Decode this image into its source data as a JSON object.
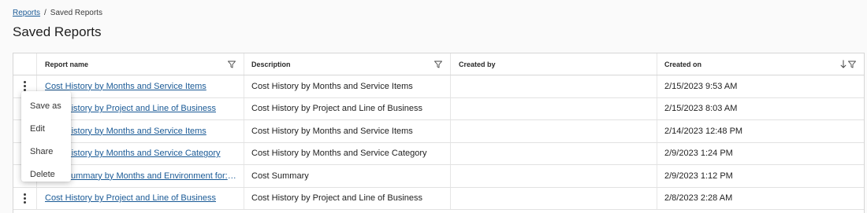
{
  "breadcrumb": {
    "root": "Reports",
    "separator": "/",
    "current": "Saved Reports"
  },
  "page": {
    "title": "Saved Reports"
  },
  "columns": {
    "name": "Report name",
    "description": "Description",
    "created_by": "Created by",
    "created_on": "Created on"
  },
  "sort": {
    "column": "Created on",
    "direction": "descending"
  },
  "rows": [
    {
      "name": "Cost History by Months and Service Items",
      "description": "Cost History by Months and Service Items",
      "created_by": "",
      "created_on": "2/15/2023 9:53 AM"
    },
    {
      "name": "Cost History by Project and Line of Business",
      "description": "Cost History by Project and Line of Business",
      "created_by": "",
      "created_on": "2/15/2023 8:03 AM"
    },
    {
      "name": "Cost History by Months and Service Items",
      "description": "Cost History by Months and Service Items",
      "created_by": "",
      "created_on": "2/14/2023 12:48 PM"
    },
    {
      "name": "Cost History by Months and Service Category",
      "description": "Cost History by Months and Service Category",
      "created_by": "",
      "created_on": "2/9/2023 1:24 PM"
    },
    {
      "name": "Cost Summary by Months and Environment for: A...",
      "description": "Cost Summary",
      "created_by": "",
      "created_on": "2/9/2023 1:12 PM"
    },
    {
      "name": "Cost History by Project and Line of Business",
      "description": "Cost History by Project and Line of Business",
      "created_by": "",
      "created_on": "2/8/2023 2:28 AM"
    }
  ],
  "row_menu": {
    "items": [
      "Save as",
      "Edit",
      "Share",
      "Delete"
    ]
  },
  "icons": {
    "filter": "filter-icon",
    "sort": "arrow-down-icon",
    "row_actions": "kebab-icon"
  },
  "colors": {
    "link": "#1a5a96",
    "border": "#d6d6d6",
    "background": "#fafafa"
  }
}
